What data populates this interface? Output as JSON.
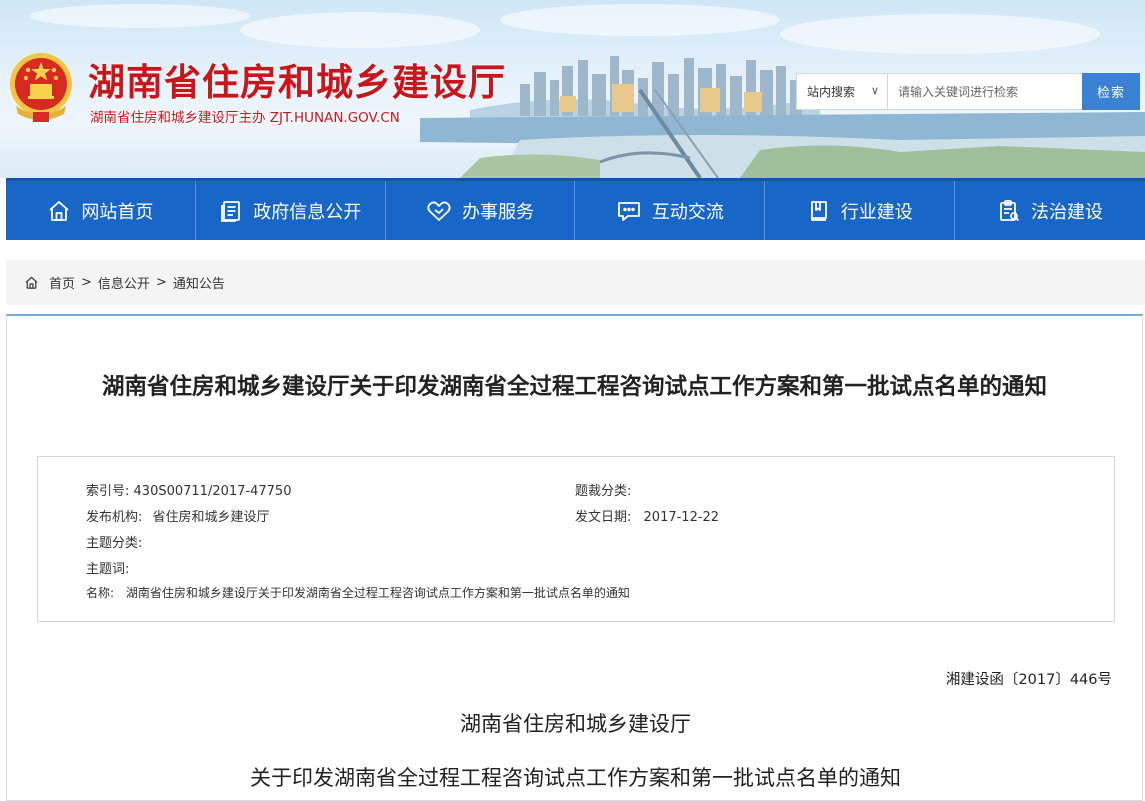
{
  "header": {
    "site_title": "湖南省住房和城乡建设厅",
    "site_subtitle": "湖南省住房和城乡建设厅主办  ZJT.HUNAN.GOV.CN",
    "emblem_icon": "national-emblem-icon",
    "search": {
      "scope_label": "站内搜索",
      "placeholder": "请输入关键词进行检索",
      "button_label": "检索"
    }
  },
  "nav": {
    "items": [
      {
        "label": "网站首页",
        "icon": "home-icon"
      },
      {
        "label": "政府信息公开",
        "icon": "document-icon"
      },
      {
        "label": "办事服务",
        "icon": "heart-icon"
      },
      {
        "label": "互动交流",
        "icon": "chat-icon"
      },
      {
        "label": "行业建设",
        "icon": "book-icon"
      },
      {
        "label": "法治建设",
        "icon": "clipboard-icon"
      }
    ]
  },
  "breadcrumb": {
    "items": [
      "首页",
      "信息公开",
      "通知公告"
    ],
    "separator": ">"
  },
  "article": {
    "title": "湖南省住房和城乡建设厅关于印发湖南省全过程工程咨询试点工作方案和第一批试点名单的通知",
    "meta": {
      "index_label": "索引号:",
      "index_value": "430S00711/2017-47750",
      "genre_label": "题裁分类:",
      "genre_value": "",
      "publisher_label": "发布机构:",
      "publisher_value": "省住房和城乡建设厅",
      "date_label": "发文日期:",
      "date_value": "2017-12-22",
      "topic_label": "主题分类:",
      "topic_value": "",
      "keywords_label": "主题词:",
      "keywords_value": "",
      "name_label": "名称:",
      "name_value": "湖南省住房和城乡建设厅关于印发湖南省全过程工程咨询试点工作方案和第一批试点名单的通知"
    },
    "doc_number": "湘建设函〔2017〕446号",
    "body_heading": "湖南省住房和城乡建设厅",
    "body_subheading": "关于印发湖南省全过程工程咨询试点工作方案和第一批试点名单的通知"
  },
  "colors": {
    "brand_red": "#c8161d",
    "nav_blue": "#1766c8",
    "search_button": "#3b82d4"
  }
}
